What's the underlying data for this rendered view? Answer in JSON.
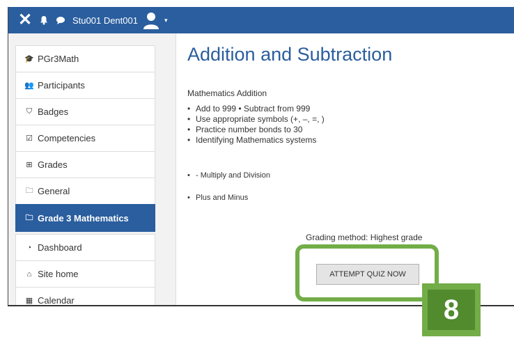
{
  "topbar": {
    "close_icon": "close-icon",
    "bell_icon": "bell-icon",
    "chat_icon": "chat-icon",
    "user_name": "Stu001 Dent001",
    "avatar_icon": "avatar-icon",
    "menu_caret": "▾"
  },
  "nav": {
    "items": [
      {
        "label": "PGr3Math",
        "icon": "graduation-cap-icon",
        "glyph": "🎓"
      },
      {
        "label": "Participants",
        "icon": "users-icon",
        "glyph": "👥"
      },
      {
        "label": "Badges",
        "icon": "shield-icon",
        "glyph": "⛉"
      },
      {
        "label": "Competencies",
        "icon": "check-square-icon",
        "glyph": "☑"
      },
      {
        "label": "Grades",
        "icon": "table-icon",
        "glyph": "⊞"
      },
      {
        "label": "General",
        "icon": "folder-icon",
        "glyph": "🗀"
      },
      {
        "label": "Grade 3 Mathematics",
        "icon": "folder-icon",
        "glyph": "🗀"
      },
      {
        "label": "Dashboard",
        "icon": "dashboard-icon",
        "glyph": "◔"
      },
      {
        "label": "Site home",
        "icon": "home-icon",
        "glyph": "⌂"
      },
      {
        "label": "Calendar",
        "icon": "calendar-icon",
        "glyph": "▦"
      }
    ],
    "active_index": 6
  },
  "main": {
    "title": "Addition and Subtraction",
    "subtitle": "Mathematics Addition",
    "bullets": [
      "Add to 999 • Subtract from 999",
      "Use appropriate symbols (+, –, =, )",
      "Practice number bonds to 30",
      "Identifying Mathematics systems"
    ],
    "bullet_multiply": "- Multiply and Division",
    "bullet_plus": "Plus and Minus",
    "grading_method": "Grading method: Highest grade",
    "attempt_button": "ATTEMPT QUIZ NOW"
  },
  "callout": {
    "step_number": "8",
    "color": "#72ad48"
  },
  "colors": {
    "brand": "#2a5e9e",
    "active_nav": "#2a5e9e",
    "sidebar_bg": "#f2f2f2"
  }
}
